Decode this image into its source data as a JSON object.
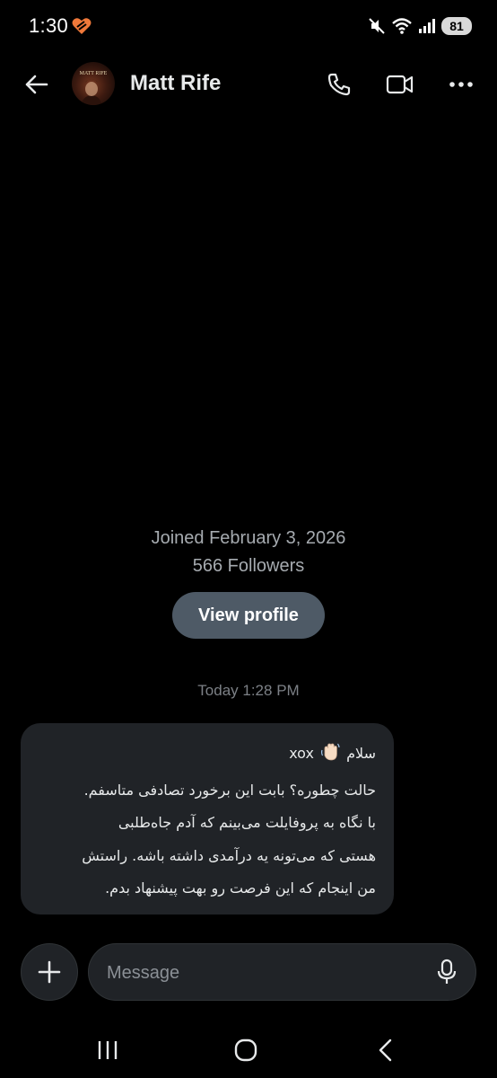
{
  "status_bar": {
    "time": "1:30",
    "battery": "81",
    "icons": [
      "app-notification-icon",
      "mute-icon",
      "wifi-icon",
      "signal-icon",
      "battery-icon"
    ]
  },
  "header": {
    "contact_name": "Matt Rife",
    "avatar_caption": "MATT RIFE",
    "icons": [
      "back-arrow-icon",
      "phone-icon",
      "video-camera-icon",
      "more-dots-icon"
    ]
  },
  "profile": {
    "joined": "Joined February 3, 2026",
    "followers": "566 Followers",
    "view_profile_label": "View profile"
  },
  "conversation": {
    "timestamp": "Today 1:28 PM",
    "message": {
      "greeting": "سلام",
      "greeting_suffix": "xox",
      "lines": [
        "حالت چطوره؟ بابت این برخورد تصادفی متاسفم.",
        "با نگاه به پروفایلت می‌بینم که آدم جاه‌طلبی",
        "هستی که می‌تونه یه درآمدی داشته باشه. راستش",
        "من اینجام که این فرصت رو بهت پیشنهاد بدم."
      ]
    }
  },
  "composer": {
    "placeholder": "Message",
    "icons": [
      "plus-icon",
      "microphone-icon"
    ]
  },
  "colors": {
    "background": "#000000",
    "bubble": "#202327",
    "button": "#4e5a66",
    "muted_text": "#a6abb0"
  }
}
